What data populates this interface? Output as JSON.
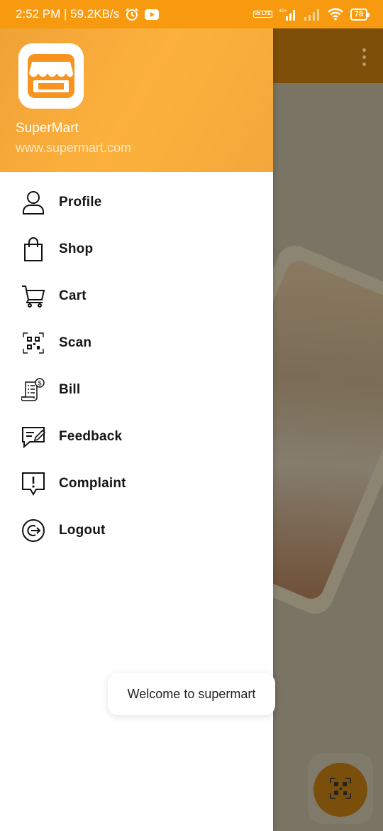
{
  "status_bar": {
    "time_speed": "2:52 PM | 59.2KB/s",
    "volte": "Vo LTE",
    "network": "4G+",
    "battery": "78"
  },
  "drawer": {
    "app_name": "SuperMart",
    "app_url": "www.supermart.com",
    "items": [
      {
        "label": "Profile",
        "icon": "person-icon"
      },
      {
        "label": "Shop",
        "icon": "shopping-bag-icon"
      },
      {
        "label": "Cart",
        "icon": "cart-icon"
      },
      {
        "label": "Scan",
        "icon": "qr-scan-icon"
      },
      {
        "label": "Bill",
        "icon": "bill-receipt-icon"
      },
      {
        "label": "Feedback",
        "icon": "feedback-icon"
      },
      {
        "label": "Complaint",
        "icon": "complaint-icon"
      },
      {
        "label": "Logout",
        "icon": "logout-icon"
      }
    ]
  },
  "toast": {
    "message": "Welcome to supermart"
  },
  "colors": {
    "status_bar": "#f79a0f",
    "header_accent": "#fdb13c",
    "logo_orange": "#f7931e"
  }
}
